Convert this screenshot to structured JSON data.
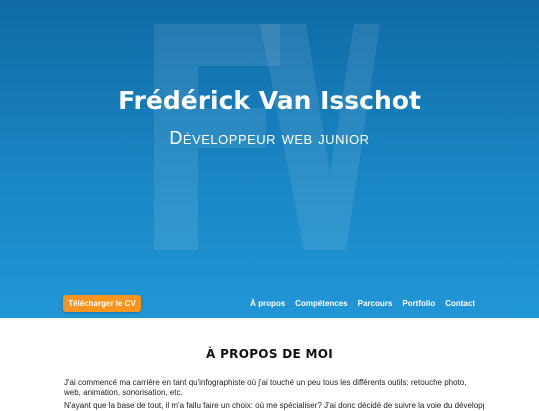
{
  "hero": {
    "title": "Frédérick Van Isschot",
    "subtitle": "Développeur web junior",
    "watermark_letters": "FV",
    "background_colors": [
      "#0f6aa5",
      "#2196d6"
    ]
  },
  "cv_button": {
    "label": "Télécharger le CV",
    "color": "#f5941e"
  },
  "nav": {
    "items": [
      {
        "label": "À propos"
      },
      {
        "label": "Compétences"
      },
      {
        "label": "Parcours"
      },
      {
        "label": "Portfolio"
      },
      {
        "label": "Contact"
      }
    ]
  },
  "about": {
    "title": "À PROPOS DE MOI",
    "paragraphs": [
      "J'ai commencé ma carrière en tant qu'infographiste où j'ai touché un peu tous les différents outils: retouche photo, web, animation, sonorisation, etc.",
      "N'ayant que la base de tout, il m'a fallu faire un choix: où me spécialiser? J'ai donc décidé de suivre la voie du développement web."
    ]
  }
}
